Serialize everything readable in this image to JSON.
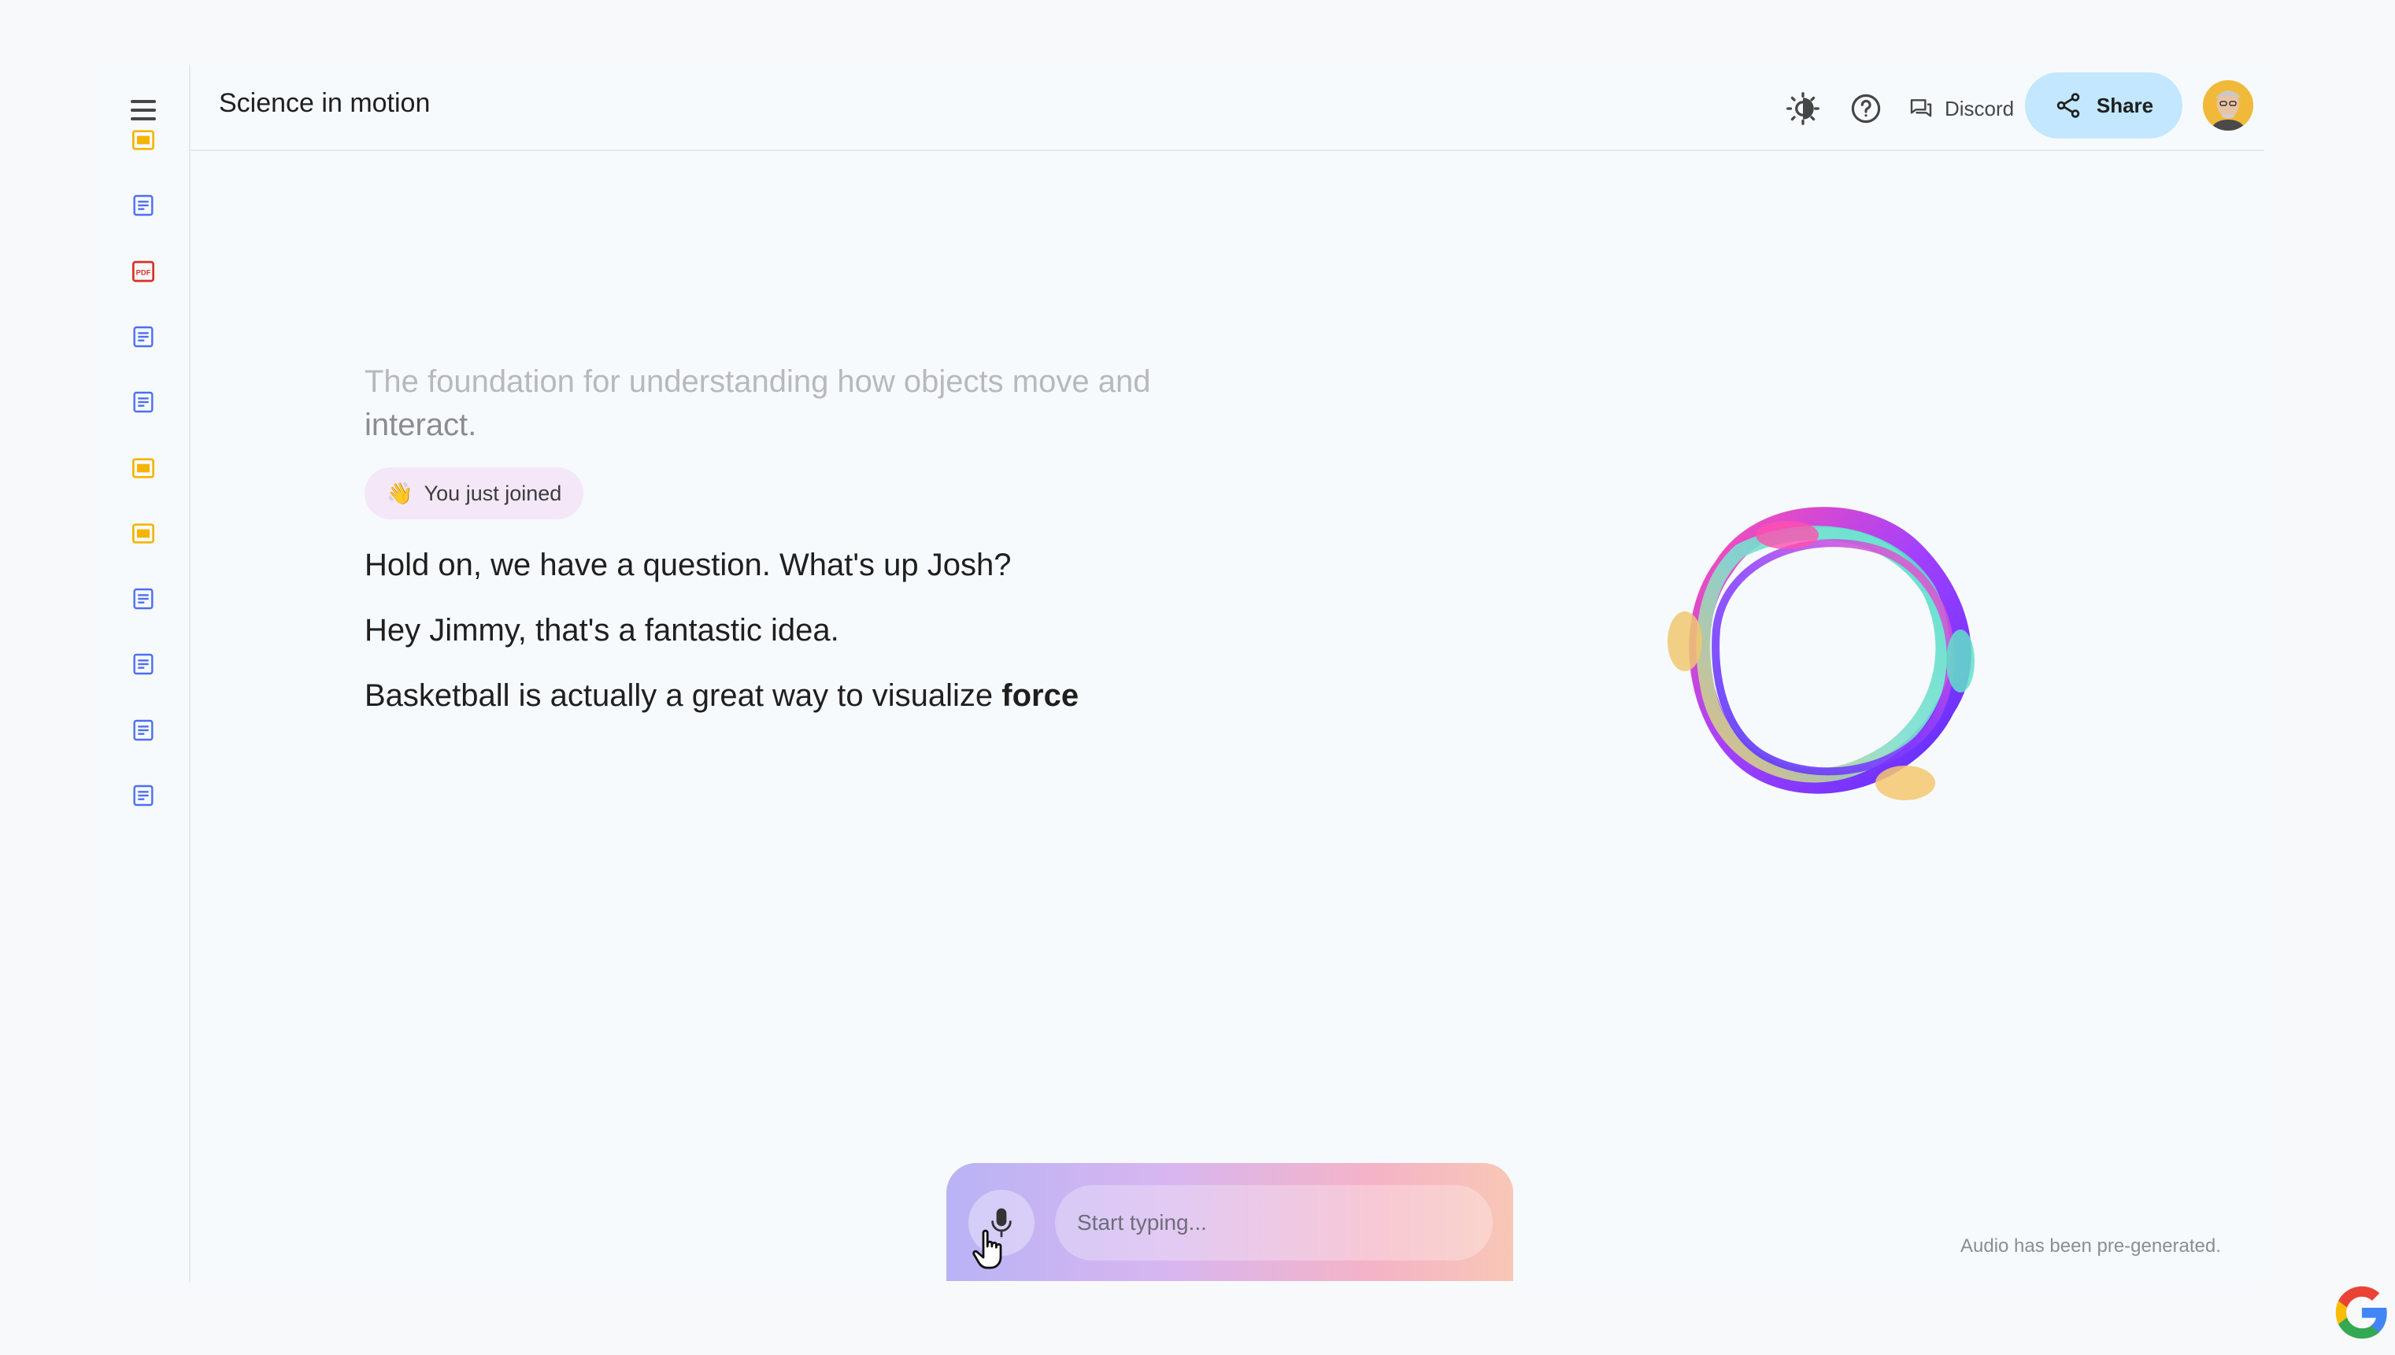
{
  "header": {
    "title": "Science in motion",
    "discord_label": "Discord",
    "share_label": "Share"
  },
  "sidebar": {
    "items": [
      {
        "icon": "slides-icon",
        "color": "#f4b400"
      },
      {
        "icon": "doc-icon",
        "color": "#4c6ef5"
      },
      {
        "icon": "pdf-icon",
        "color": "#d93025"
      },
      {
        "icon": "doc-icon",
        "color": "#4c6ef5"
      },
      {
        "icon": "doc-icon",
        "color": "#4c6ef5"
      },
      {
        "icon": "slides-icon",
        "color": "#f4b400"
      },
      {
        "icon": "slides-icon",
        "color": "#f4b400"
      },
      {
        "icon": "doc-icon",
        "color": "#4c6ef5"
      },
      {
        "icon": "doc-icon",
        "color": "#4c6ef5"
      },
      {
        "icon": "doc-icon",
        "color": "#4c6ef5"
      },
      {
        "icon": "doc-icon",
        "color": "#4c6ef5"
      }
    ]
  },
  "main": {
    "faded_text_1": "The foundation for understanding how objects move and",
    "faded_text_2": "interact.",
    "joined_emoji": "👋",
    "joined_label": "You just joined",
    "line_1": "Hold on, we have a question. What's up Josh?",
    "line_2": "Hey Jimmy, that's a fantastic idea.",
    "line_3_prefix": "Basketball is actually a great way to visualize ",
    "line_3_bold": "force"
  },
  "composer": {
    "placeholder": "Start typing..."
  },
  "footnote": "Audio has been pre-generated.",
  "colors": {
    "share_bg": "#c2e7ff",
    "slides": "#f4b400",
    "doc": "#4c6ef5",
    "pdf": "#d93025"
  }
}
